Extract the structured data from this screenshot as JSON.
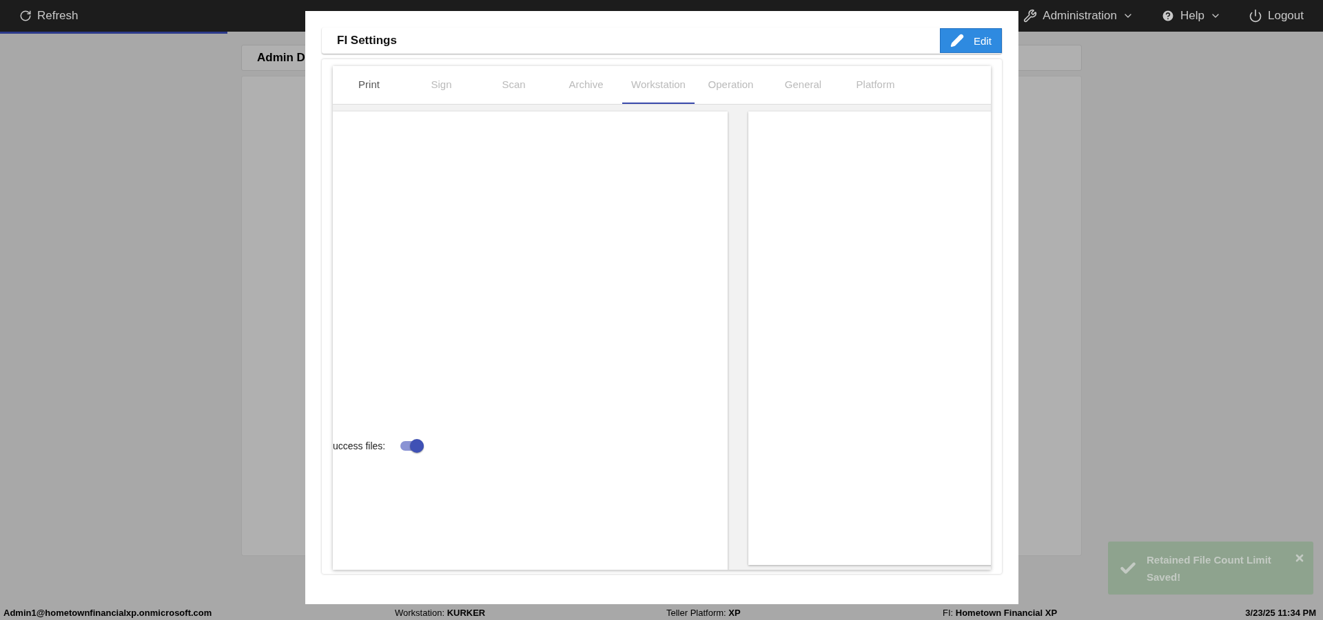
{
  "top_bar": {
    "refresh": "Refresh",
    "progress": {
      "level": 0.172
    },
    "menus": [
      {
        "kind": "admin",
        "label": "Administration",
        "dropdown": true
      },
      {
        "kind": "help",
        "label": "Help",
        "dropdown": true
      },
      {
        "kind": "logout",
        "label": "Logout",
        "dropdown": false
      }
    ]
  },
  "background_card": {
    "title": "Admin D"
  },
  "modal": {
    "title": "FI Settings",
    "edit_button": "Edit",
    "tabs": [
      {
        "label": "Print",
        "selected": false,
        "focused": true
      },
      {
        "label": "Sign",
        "selected": false,
        "focused": false
      },
      {
        "label": "Scan",
        "selected": false,
        "focused": false
      },
      {
        "label": "Archive",
        "selected": false,
        "focused": false
      },
      {
        "label": "Workstation",
        "selected": true,
        "focused": false
      },
      {
        "label": "Operation",
        "selected": false,
        "focused": false
      },
      {
        "label": "General",
        "selected": false,
        "focused": false
      },
      {
        "label": "Platform",
        "selected": false,
        "focused": false
      }
    ],
    "setting": {
      "label": "uccess files:",
      "on": true
    }
  },
  "toast": {
    "message": "Retained File Count Limit Saved!"
  },
  "status_bar": {
    "user": "Admin1@hometownfinancialxp.onmicrosoft.com",
    "workstation": "Workstation: **KURKER**",
    "platform": "Teller Platform: **XP**",
    "fi": "FI: **Hometown Financial XP**",
    "datetime": "3/23/25 11:34 PM"
  }
}
